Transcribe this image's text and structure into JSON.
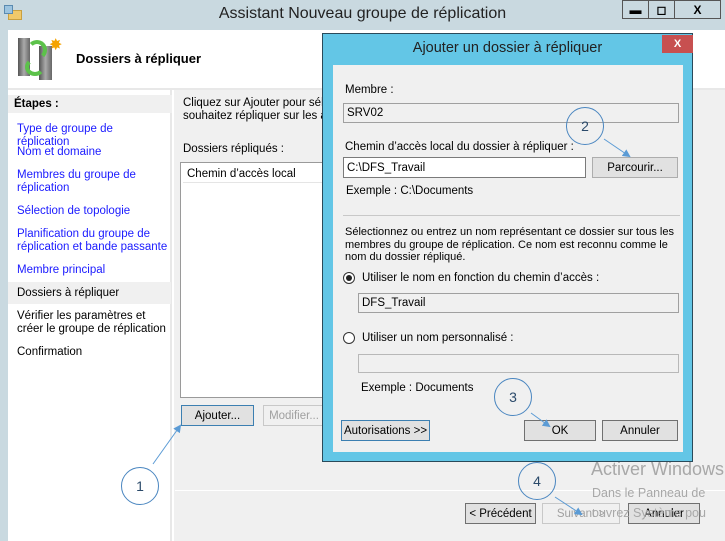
{
  "window": {
    "title": "Assistant Nouveau groupe de réplication",
    "min": "▬",
    "max": "◻",
    "close": "X"
  },
  "header": {
    "title": "Dossiers à répliquer"
  },
  "steps": {
    "heading": "Étapes :",
    "items": [
      {
        "label": "Type de groupe de réplication",
        "state": "done"
      },
      {
        "label": "Nom et domaine",
        "state": "done"
      },
      {
        "label": "Membres du groupe de réplication",
        "state": "done"
      },
      {
        "label": "Sélection de topologie",
        "state": "done"
      },
      {
        "label": "Planification du groupe de réplication et bande passante",
        "state": "done"
      },
      {
        "label": "Membre principal",
        "state": "done"
      },
      {
        "label": "Dossiers à répliquer",
        "state": "current"
      },
      {
        "label": "Vérifier les paramètres et créer le groupe de réplication",
        "state": "todo"
      },
      {
        "label": "Confirmation",
        "state": "todo"
      }
    ]
  },
  "main": {
    "instr1": "Cliquez sur Ajouter pour sélec",
    "instr2": "souhaitez répliquer sur les aut",
    "list_label": "Dossiers répliqués :",
    "column": "Chemin d’accès local",
    "add": "Ajouter...",
    "edit": "Modifier..."
  },
  "footer": {
    "prev": "< Précédent",
    "next": "Suivant >",
    "cancel": "Annuler"
  },
  "dialog": {
    "title": "Ajouter un dossier à répliquer",
    "close": "X",
    "member_label": "Membre :",
    "member_value": "SRV02",
    "path_label": "Chemin d’accès local du dossier à répliquer :",
    "path_value": "C:\\DFS_Travail",
    "browse": "Parcourir...",
    "path_example": "Exemple : C:\\Documents",
    "desc": "Sélectionnez ou entrez un nom représentant ce dossier sur tous les membres du groupe de réplication. Ce nom est reconnu comme le nom du dossier répliqué.",
    "radio1": "Utiliser le nom en fonction du chemin d’accès :",
    "radio1_value": "DFS_Travail",
    "radio1_selected": true,
    "radio2": "Utiliser un nom personnalisé :",
    "radio2_value": "",
    "radio2_selected": false,
    "name_example": "Exemple : Documents",
    "permissions": "Autorisations >>",
    "ok": "OK",
    "cancel": "Annuler"
  },
  "annotations": [
    "1",
    "2",
    "3",
    "4"
  ],
  "watermark": {
    "line1": "Activer Windows",
    "line2": "Dans le Panneau de",
    "line3": "ouvrez Système pou"
  },
  "colors": {
    "dialog_frame": "#63c6e6",
    "close_red": "#c75050",
    "link": "#1a1aff",
    "annotation": "#4a86c0"
  }
}
